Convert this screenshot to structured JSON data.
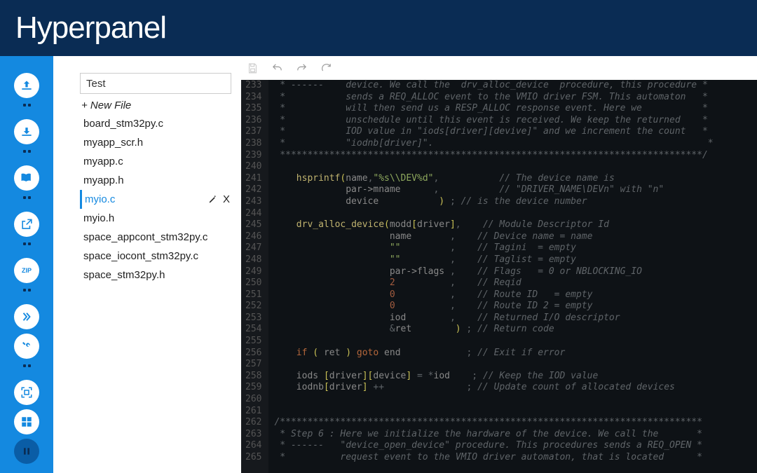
{
  "header": {
    "title": "Hyperpanel"
  },
  "sidebar": {
    "items": [
      {
        "name": "upload-icon"
      },
      {
        "name": "download-icon"
      },
      {
        "name": "book-icon"
      },
      {
        "name": "export-icon"
      },
      {
        "name": "zip-icon"
      },
      {
        "name": "forward-icon"
      },
      {
        "name": "tools-icon"
      },
      {
        "name": "focus-icon"
      },
      {
        "name": "layout-icon"
      },
      {
        "name": "pause-icon"
      }
    ]
  },
  "filePanel": {
    "inputValue": "Test",
    "newFileLabel": "+ New File",
    "files": [
      {
        "name": "board_stm32py.c",
        "active": false
      },
      {
        "name": "myapp_scr.h",
        "active": false
      },
      {
        "name": "myapp.c",
        "active": false
      },
      {
        "name": "myapp.h",
        "active": false
      },
      {
        "name": "myio.c",
        "active": true
      },
      {
        "name": "myio.h",
        "active": false
      },
      {
        "name": "space_appcont_stm32py.c",
        "active": false
      },
      {
        "name": "space_iocont_stm32py.c",
        "active": false
      },
      {
        "name": "space_stm32py.h",
        "active": false
      }
    ]
  },
  "editor": {
    "startLine": 233,
    "lines": [
      {
        "html": "<span class='c-comment'> * ------    device. We call the  drv_alloc_device  procedure, this procedure *</span>"
      },
      {
        "html": "<span class='c-comment'> *           sends a REQ_ALLOC event to the VMIO driver FSM. This automaton   *</span>"
      },
      {
        "html": "<span class='c-comment'> *           will then send us a RESP_ALLOC response event. Here we           *</span>"
      },
      {
        "html": "<span class='c-comment'> *           unschedule until this event is received. We keep the returned    *</span>"
      },
      {
        "html": "<span class='c-comment'> *           IOD value in \"iods[driver][devive]\" and we increment the count   *</span>"
      },
      {
        "html": "<span class='c-comment'> *           \"iodnb[driver]\".                                                  *</span>"
      },
      {
        "html": "<span class='c-comment'> *****************************************************************************/</span>"
      },
      {
        "html": ""
      },
      {
        "html": "    <span class='c-fn'>hsprintf</span><span class='c-paren'>(</span><span class='c-id'>name</span>,<span class='c-str'>\"%s\\\\DEV%d\"</span>,           <span class='c-comment'>// The device name is</span>"
      },
      {
        "html": "             <span class='c-id'>par-&gt;mname</span>      ,           <span class='c-comment'>// \"DRIVER_NAME\\DEVn\" with \"n\"</span>"
      },
      {
        "html": "             <span class='c-id'>device</span>           <span class='c-paren'>)</span> ; <span class='c-comment'>// is the device number</span>"
      },
      {
        "html": ""
      },
      {
        "html": "    <span class='c-fn'>drv_alloc_device</span><span class='c-paren'>(</span><span class='c-id'>modd</span><span class='c-paren'>[</span><span class='c-id'>driver</span><span class='c-paren'>]</span>,    <span class='c-comment'>// Module Descriptor Id</span>"
      },
      {
        "html": "                     <span class='c-id'>name</span>       ,    <span class='c-comment'>// Device name = name</span>"
      },
      {
        "html": "                     <span class='c-str'>\"\"</span>         ,    <span class='c-comment'>// Tagini  = empty</span>"
      },
      {
        "html": "                     <span class='c-str'>\"\"</span>         ,    <span class='c-comment'>// Taglist = empty</span>"
      },
      {
        "html": "                     <span class='c-id'>par-&gt;flags</span> ,    <span class='c-comment'>// Flags   = 0 or NBLOCKING_IO</span>"
      },
      {
        "html": "                     <span class='c-num'>2</span>          ,    <span class='c-comment'>// Reqid</span>"
      },
      {
        "html": "                     <span class='c-num'>0</span>          ,    <span class='c-comment'>// Route ID   = empty</span>"
      },
      {
        "html": "                     <span class='c-num'>0</span>          ,    <span class='c-comment'>// Route ID 2 = empty</span>"
      },
      {
        "html": "                     <span class='c-id'>iod</span>        ,    <span class='c-comment'>// Returned I/O descriptor</span>"
      },
      {
        "html": "                     &amp;<span class='c-id'>ret</span>        <span class='c-paren'>)</span> ; <span class='c-comment'>// Return code</span>"
      },
      {
        "html": ""
      },
      {
        "html": "    <span class='c-kw'>if</span> <span class='c-paren'>(</span> <span class='c-id'>ret</span> <span class='c-paren'>)</span> <span class='c-kw'>goto</span> <span class='c-id'>end</span>            ; <span class='c-comment'>// Exit if error</span>"
      },
      {
        "html": ""
      },
      {
        "html": "    <span class='c-id'>iods</span> <span class='c-paren'>[</span><span class='c-id'>driver</span><span class='c-paren'>][</span><span class='c-id'>device</span><span class='c-paren'>]</span> = *<span class='c-id'>iod</span>    ; <span class='c-comment'>// Keep the IOD value</span>"
      },
      {
        "html": "    <span class='c-id'>iodnb</span><span class='c-paren'>[</span><span class='c-id'>driver</span><span class='c-paren'>]</span> ++               ; <span class='c-comment'>// Update count of allocated devices</span>"
      },
      {
        "html": ""
      },
      {
        "html": ""
      },
      {
        "html": "<span class='c-comment'>/*****************************************************************************</span>"
      },
      {
        "html": "<span class='c-comment'> * Step 6 : Here we initialize the hardware of the device. We call the       *</span>"
      },
      {
        "html": "<span class='c-comment'> * ------   \"device_open_device\" procedure. This procedures sends a REQ_OPEN *</span>"
      },
      {
        "html": "<span class='c-comment'> *          request event to the VMIO driver automaton, that is located      *</span>"
      }
    ]
  }
}
